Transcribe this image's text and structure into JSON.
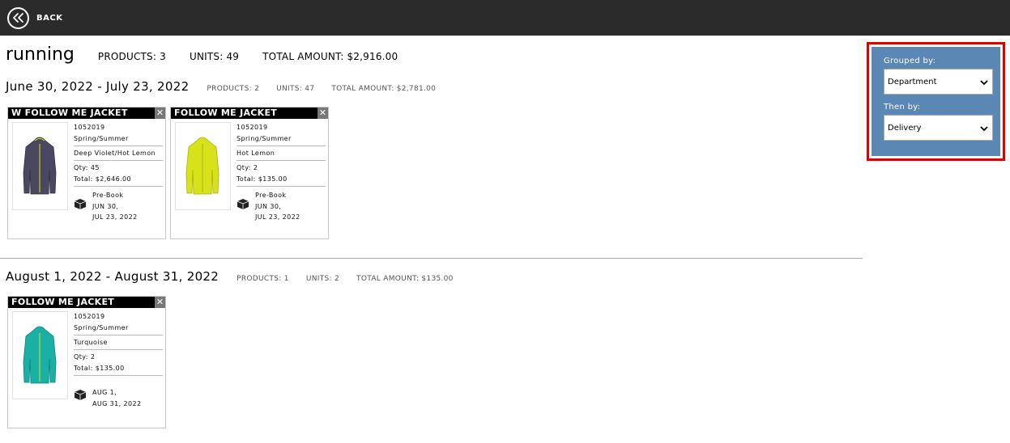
{
  "header": {
    "back_label": "BACK"
  },
  "page": {
    "title": "running",
    "products": "PRODUCTS: 3",
    "units": "UNITS: 49",
    "total": "TOTAL AMOUNT: $2,916.00"
  },
  "groups": [
    {
      "title": "June 30, 2022 - July 23, 2022",
      "products": "PRODUCTS: 2",
      "units": "UNITS: 47",
      "total": "TOTAL AMOUNT: $2,781.00",
      "cards": [
        {
          "name": "W FOLLOW ME JACKET",
          "sku": "1052019",
          "season": "Spring/Summer",
          "color": "Deep Violet/Hot Lemon",
          "qty": "Qty: 45",
          "total": "Total: $2,646.00",
          "delivery_type": "Pre-Book",
          "delivery_start": "JUN 30,",
          "delivery_end": "JUL 23, 2022",
          "swatch": "#4a4860"
        },
        {
          "name": "FOLLOW ME JACKET",
          "sku": "1052019",
          "season": "Spring/Summer",
          "color": "Hot Lemon",
          "qty": "Qty: 2",
          "total": "Total: $135.00",
          "delivery_type": "Pre-Book",
          "delivery_start": "JUN 30,",
          "delivery_end": "JUL 23, 2022",
          "swatch": "#d8e21a"
        }
      ]
    },
    {
      "title": "August 1, 2022 - August 31, 2022",
      "products": "PRODUCTS: 1",
      "units": "UNITS: 2",
      "total": "TOTAL AMOUNT: $135.00",
      "cards": [
        {
          "name": "FOLLOW ME JACKET",
          "sku": "1052019",
          "season": "Spring/Summer",
          "color": "Turquoise",
          "qty": "Qty: 2",
          "total": "Total: $135.00",
          "delivery_start": "AUG 1,",
          "delivery_end": "AUG 31, 2022",
          "swatch": "#1ab0a5"
        }
      ]
    }
  ],
  "filters": {
    "grouped_by_label": "Grouped by:",
    "grouped_by_value": "Department",
    "then_by_label": "Then by:",
    "then_by_value": "Delivery"
  },
  "colors": {
    "topbar": "#2b2b2b",
    "filter_panel": "#5b87b5",
    "highlight": "#e00000"
  }
}
